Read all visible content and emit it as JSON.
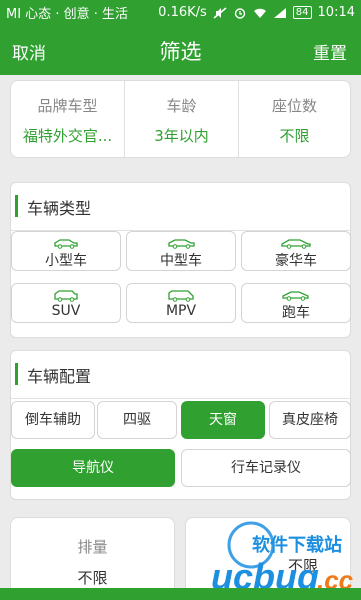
{
  "status_bar": {
    "carrier": "MI 心态 · 创意 · 生活",
    "speed": "0.16K/s",
    "battery": "84",
    "time": "10:14"
  },
  "header": {
    "cancel": "取消",
    "title": "筛选",
    "reset": "重置"
  },
  "summary": [
    {
      "label": "品牌车型",
      "value": "福特外交官..."
    },
    {
      "label": "车龄",
      "value": "3年以内"
    },
    {
      "label": "座位数",
      "value": "不限"
    }
  ],
  "vehicle_type": {
    "title": "车辆类型",
    "items": [
      {
        "label": "小型车",
        "icon": "compact-car-icon"
      },
      {
        "label": "中型车",
        "icon": "midsize-car-icon"
      },
      {
        "label": "豪华车",
        "icon": "luxury-car-icon"
      },
      {
        "label": "SUV",
        "icon": "suv-icon"
      },
      {
        "label": "MPV",
        "icon": "mpv-icon"
      },
      {
        "label": "跑车",
        "icon": "sports-car-icon"
      }
    ]
  },
  "config": {
    "title": "车辆配置",
    "options": [
      {
        "label": "倒车辅助",
        "selected": false
      },
      {
        "label": "四驱",
        "selected": false
      },
      {
        "label": "天窗",
        "selected": true
      },
      {
        "label": "真皮座椅",
        "selected": false
      },
      {
        "label": "导航仪",
        "selected": true
      },
      {
        "label": "行车记录仪",
        "selected": false
      }
    ]
  },
  "bottom": [
    {
      "label": "排量",
      "value": "不限"
    },
    {
      "label": "",
      "value": "不限"
    }
  ],
  "watermark": {
    "brand": "ucbug",
    "domain": ".cc",
    "cn": "软件下载站"
  },
  "colors": {
    "primary": "#30a031",
    "background": "#ebebeb"
  }
}
